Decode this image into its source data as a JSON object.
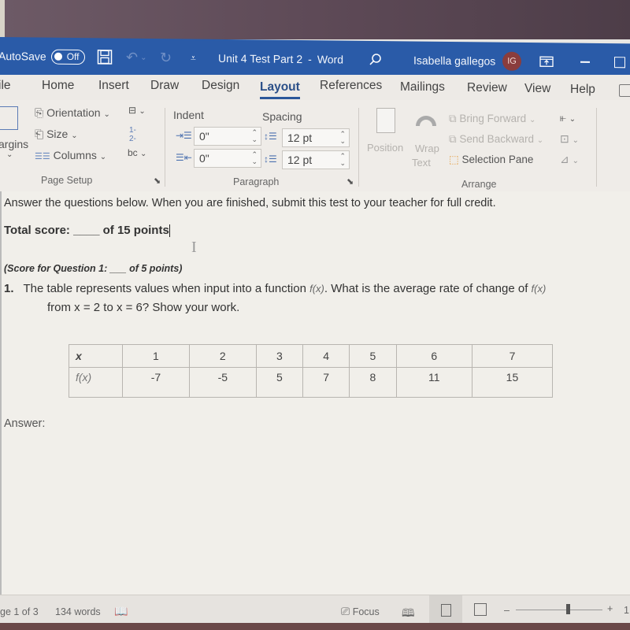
{
  "titlebar": {
    "autosave_label": "AutoSave",
    "autosave_state": "Off",
    "document_title": "Unit 4 Test Part 2",
    "separator": "-",
    "app_name": "Word",
    "user_name": "Isabella gallegos",
    "user_initials": "IG"
  },
  "tabs": [
    {
      "label": "ile"
    },
    {
      "label": "Home"
    },
    {
      "label": "Insert"
    },
    {
      "label": "Draw"
    },
    {
      "label": "Design"
    },
    {
      "label": "Layout",
      "active": true
    },
    {
      "label": "References"
    },
    {
      "label": "Mailings"
    },
    {
      "label": "Review"
    },
    {
      "label": "View"
    },
    {
      "label": "Help"
    }
  ],
  "ribbon": {
    "page_setup": {
      "margins": "argins",
      "orientation": "Orientation",
      "size": "Size",
      "columns": "Columns",
      "group_label": "Page Setup"
    },
    "paragraph": {
      "indent_label": "Indent",
      "spacing_label": "Spacing",
      "indent_left": "0\"",
      "indent_right": "0\"",
      "spacing_before": "12 pt",
      "spacing_after": "12 pt",
      "group_label": "Paragraph"
    },
    "arrange": {
      "position": "Position",
      "wrap_text_line1": "Wrap",
      "wrap_text_line2": "Text",
      "bring_forward": "Bring Forward",
      "send_backward": "Send Backward",
      "selection_pane": "Selection Pane",
      "group_label": "Arrange"
    }
  },
  "document": {
    "instructions": "Answer the questions below. When you are finished, submit this test to your teacher for full credit.",
    "total_score_label": "Total score:",
    "total_score_blank": "____",
    "total_score_suffix": "of 15 points",
    "q1_score_prefix": "(Score for Question 1:",
    "q1_score_blank": "___",
    "q1_score_suffix": "of 5 points)",
    "q1_number": "1.",
    "q1_text_a": "The table represents values when input into a function",
    "q1_fx1": "f(x)",
    "q1_text_b": ". What is the average rate of change of",
    "q1_fx2": "f(x)",
    "q1_line2": "from x = 2 to x = 6? Show your work.",
    "table": {
      "row_headers": [
        "x",
        "f(x)"
      ],
      "x": [
        "1",
        "2",
        "3",
        "4",
        "5",
        "6",
        "7"
      ],
      "fx": [
        "-7",
        "-5",
        "5",
        "7",
        "8",
        "11",
        "15"
      ]
    },
    "answer_label": "Answer:"
  },
  "statusbar": {
    "page_info": "ge 1 of 3",
    "word_count": "134 words",
    "focus_label": "Focus",
    "zoom_fraction": 0.6,
    "zoom_level_partial": "1"
  }
}
